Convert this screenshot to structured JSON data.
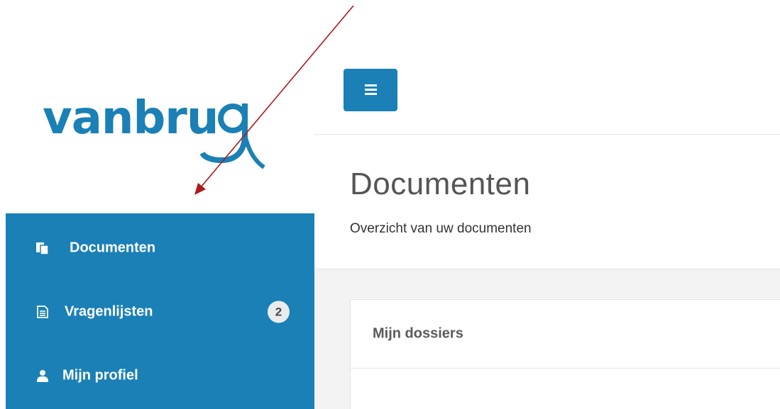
{
  "brand": {
    "logo_text": "vanbrug",
    "logo_color": "#1a80b6"
  },
  "colors": {
    "primary": "#1a80b6",
    "annotation_arrow": "#b01818",
    "content_background": "#f3f3f3"
  },
  "sidebar": {
    "items": [
      {
        "label": "Documenten",
        "icon": "documents-icon",
        "badge": null
      },
      {
        "label": "Vragenlijsten",
        "icon": "questionnaire-icon",
        "badge": "2"
      },
      {
        "label": "Mijn profiel",
        "icon": "user-icon",
        "badge": null
      }
    ]
  },
  "header": {
    "menu_toggle_icon": "hamburger-menu-icon"
  },
  "page": {
    "title": "Documenten",
    "subtitle": "Overzicht van uw documenten"
  },
  "card": {
    "title": "Mijn dossiers"
  }
}
